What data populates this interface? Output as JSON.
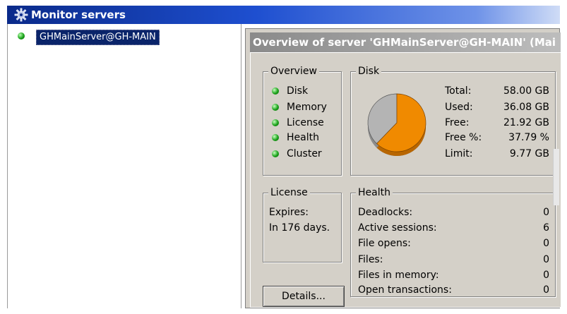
{
  "window": {
    "title": "Monitor servers",
    "icon": "gear-icon"
  },
  "tree": {
    "items": [
      {
        "label": "GHMainServer@GH-MAIN",
        "status": "online",
        "status_color": "#1aa21a"
      }
    ]
  },
  "panel": {
    "title": "Overview of server 'GHMainServer@GH-MAIN' (Mai",
    "overview": {
      "heading": "Overview",
      "items": [
        {
          "label": "Disk",
          "status": "ok"
        },
        {
          "label": "Memory",
          "status": "ok"
        },
        {
          "label": "License",
          "status": "ok"
        },
        {
          "label": "Health",
          "status": "ok"
        },
        {
          "label": "Cluster",
          "status": "ok"
        }
      ]
    },
    "disk": {
      "heading": "Disk",
      "rows": [
        {
          "label": "Total:",
          "value": "58.00 GB"
        },
        {
          "label": "Used:",
          "value": "36.08 GB"
        },
        {
          "label": "Free:",
          "value": "21.92 GB"
        },
        {
          "label": "Free %:",
          "value": "37.79 %"
        },
        {
          "label": "Limit:",
          "value": "9.77 GB"
        }
      ],
      "pie": {
        "used_fraction": 0.6221,
        "used_color": "#f08a00",
        "free_color": "#b4b4b4"
      }
    },
    "license": {
      "heading": "License",
      "expires_label": "Expires:",
      "expires_value": "In 176 days."
    },
    "health": {
      "heading": "Health",
      "rows": [
        {
          "label": "Deadlocks:",
          "value": "0"
        },
        {
          "label": "Active sessions:",
          "value": "6"
        },
        {
          "label": "File opens:",
          "value": "0"
        },
        {
          "label": "Files:",
          "value": "0"
        },
        {
          "label": "Files in memory:",
          "value": "0"
        },
        {
          "label": "Open transactions:",
          "value": "0"
        }
      ]
    },
    "details_button": "Details..."
  }
}
